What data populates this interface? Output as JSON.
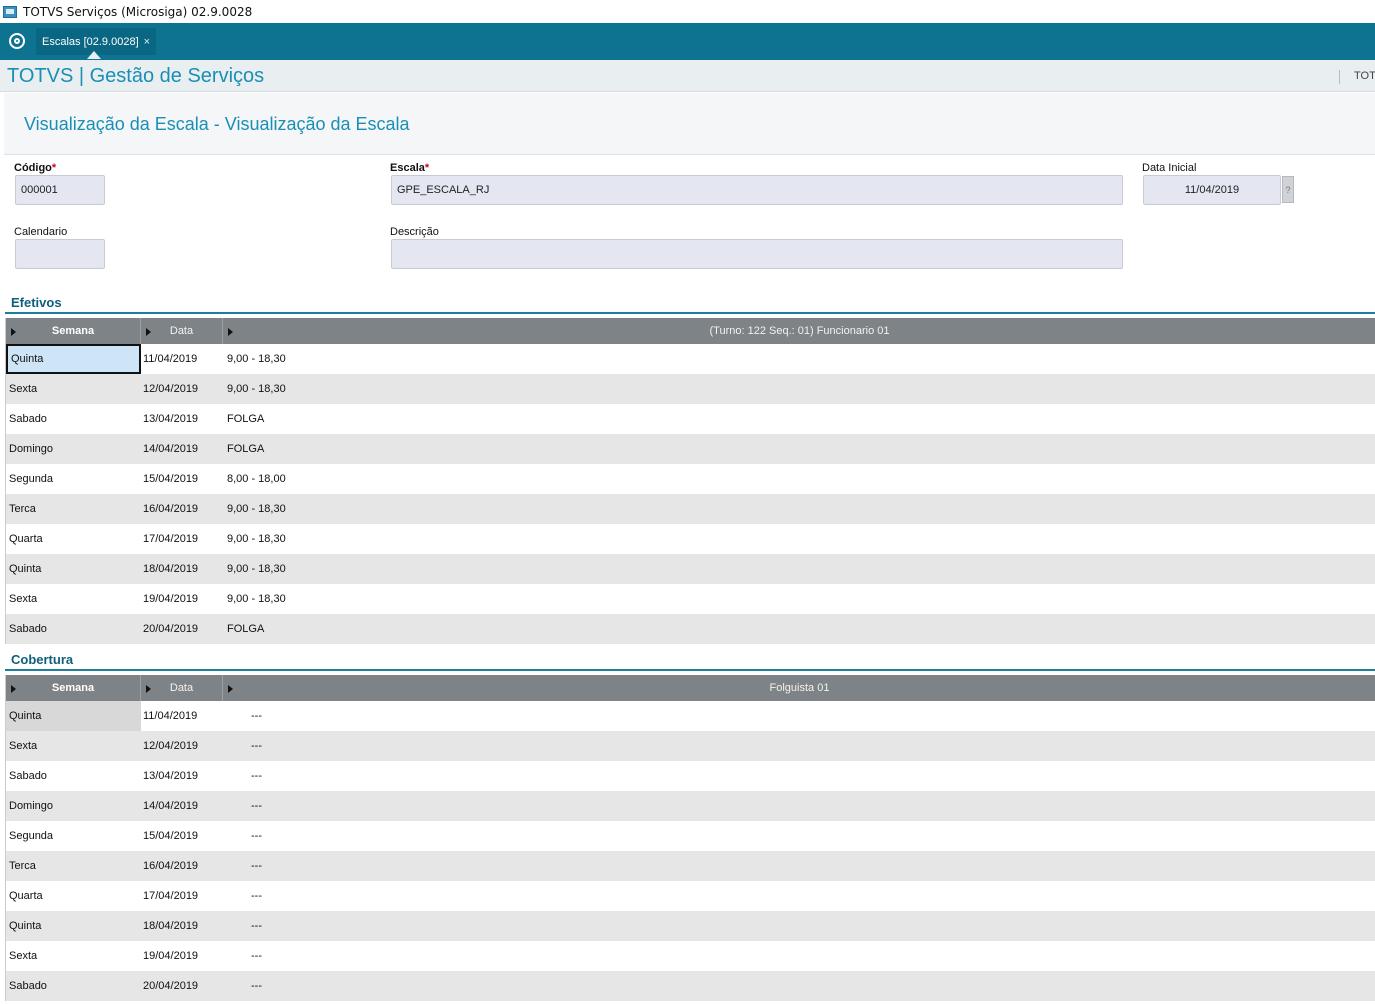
{
  "window": {
    "title": "TOTVS Serviços (Microsiga) 02.9.0028"
  },
  "tabs": [
    {
      "label": "Escalas [02.9.0028]",
      "close": "×"
    }
  ],
  "app": {
    "brand": "TOTVS | Gestão de Serviços",
    "right_text": "TOT"
  },
  "page": {
    "title": "Visualização da Escala - Visualização da Escala"
  },
  "form": {
    "codigo": {
      "label": "Código",
      "required_mark": "*",
      "value": "000001"
    },
    "escala": {
      "label": "Escala",
      "required_mark": "*",
      "value": "GPE_ESCALA_RJ"
    },
    "data_inicial": {
      "label": "Data Inicial",
      "value": "11/04/2019",
      "help": "?"
    },
    "calendario": {
      "label": "Calendario",
      "value": ""
    },
    "descricao": {
      "label": "Descrição",
      "value": ""
    }
  },
  "efetivos": {
    "title": "Efetivos",
    "columns": [
      "Semana",
      "Data",
      "(Turno: 122 Seq.: 01) Funcionario 01"
    ],
    "rows": [
      [
        "Quinta",
        "11/04/2019",
        "9,00 - 18,30"
      ],
      [
        "Sexta",
        "12/04/2019",
        "9,00 - 18,30"
      ],
      [
        "Sabado",
        "13/04/2019",
        "FOLGA"
      ],
      [
        "Domingo",
        "14/04/2019",
        "FOLGA"
      ],
      [
        "Segunda",
        "15/04/2019",
        "8,00 - 18,00"
      ],
      [
        "Terca",
        "16/04/2019",
        "9,00 - 18,30"
      ],
      [
        "Quarta",
        "17/04/2019",
        "9,00 - 18,30"
      ],
      [
        "Quinta",
        "18/04/2019",
        "9,00 - 18,30"
      ],
      [
        "Sexta",
        "19/04/2019",
        "9,00 - 18,30"
      ],
      [
        "Sabado",
        "20/04/2019",
        "FOLGA"
      ]
    ]
  },
  "cobertura": {
    "title": "Cobertura",
    "columns": [
      "Semana",
      "Data",
      "Folguista 01"
    ],
    "rows": [
      [
        "Quinta",
        "11/04/2019",
        "---"
      ],
      [
        "Sexta",
        "12/04/2019",
        "---"
      ],
      [
        "Sabado",
        "13/04/2019",
        "---"
      ],
      [
        "Domingo",
        "14/04/2019",
        "---"
      ],
      [
        "Segunda",
        "15/04/2019",
        "---"
      ],
      [
        "Terca",
        "16/04/2019",
        "---"
      ],
      [
        "Quarta",
        "17/04/2019",
        "---"
      ],
      [
        "Quinta",
        "18/04/2019",
        "---"
      ],
      [
        "Sexta",
        "19/04/2019",
        "---"
      ],
      [
        "Sabado",
        "20/04/2019",
        "---"
      ]
    ]
  }
}
